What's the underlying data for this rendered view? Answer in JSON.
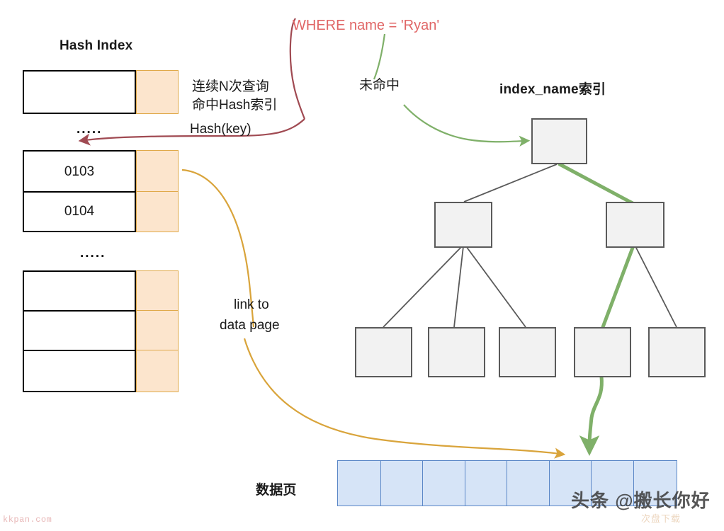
{
  "diagram": {
    "headings": {
      "hash_index": "Hash Index",
      "btree_index": "index_name索引"
    },
    "annotations": {
      "where_clause": "WHERE name = 'Ryan'",
      "miss": "未命中",
      "hash_note_line1": "连续N次查询",
      "hash_note_line2": "命中Hash索引",
      "hash_note_line3": "Hash(key)",
      "link_line1": "link to",
      "link_line2": "data page",
      "data_page_label": "数据页",
      "ellipsis_1": ".....",
      "ellipsis_2": "....."
    },
    "hash_index": {
      "groups": [
        {
          "rows": [
            {
              "key": ""
            }
          ]
        },
        {
          "rows": [
            {
              "key": "0103"
            },
            {
              "key": "0104"
            }
          ]
        },
        {
          "rows": [
            {
              "key": ""
            },
            {
              "key": ""
            },
            {
              "key": ""
            }
          ]
        }
      ]
    },
    "btree": {
      "root": {
        "label": ""
      },
      "internal": [
        {
          "label": ""
        },
        {
          "label": ""
        }
      ],
      "leaves": [
        {
          "label": ""
        },
        {
          "label": ""
        },
        {
          "label": ""
        },
        {
          "label": ""
        },
        {
          "label": ""
        }
      ],
      "highlight_path": [
        "root",
        "internal-1",
        "leaf-3"
      ]
    },
    "data_page": {
      "cells": [
        "",
        "",
        "",
        "",
        "",
        "",
        "",
        ""
      ],
      "target_cell_index": 5
    },
    "watermarks": {
      "bottom_left": "kkpan.com",
      "bottom_right": "头条 @搬长你好",
      "bottom_right_small": "次盘下载"
    },
    "colors": {
      "where_text": "#e06666",
      "hash_arrow": "#a04a52",
      "green_arrow": "#7fb069",
      "orange_arrow": "#d9a43b",
      "hash_cell_fill": "#fce5cd",
      "hash_cell_border": "#e0a94a",
      "node_fill": "#f2f2f2",
      "node_border": "#5a5a5a",
      "data_cell_fill": "#d6e4f7",
      "data_cell_border": "#5b87c7"
    }
  }
}
